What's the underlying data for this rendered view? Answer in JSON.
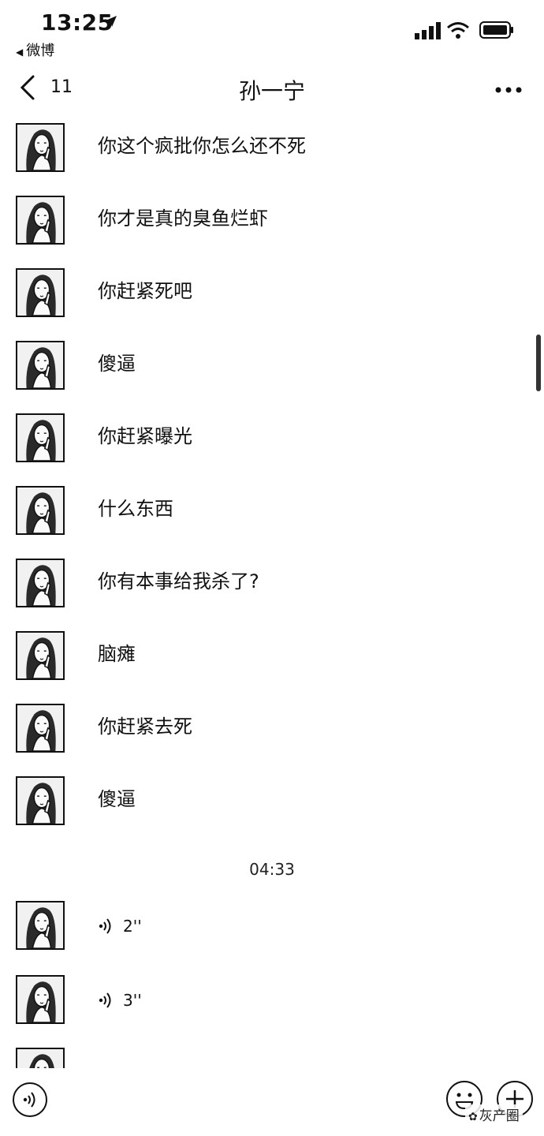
{
  "status_bar": {
    "time": "13:25",
    "back_app_label": "微博"
  },
  "nav": {
    "back_count": "11",
    "title": "孙一宁"
  },
  "messages": [
    {
      "type": "text",
      "text": "你这个疯批你怎么还不死"
    },
    {
      "type": "text",
      "text": "你才是真的臭鱼烂虾"
    },
    {
      "type": "text",
      "text": "你赶紧死吧"
    },
    {
      "type": "text",
      "text": "傻逼"
    },
    {
      "type": "text",
      "text": "你赶紧曝光"
    },
    {
      "type": "text",
      "text": "什么东西"
    },
    {
      "type": "text",
      "text": "你有本事给我杀了?"
    },
    {
      "type": "text",
      "text": "脑瘫"
    },
    {
      "type": "text",
      "text": "你赶紧去死"
    },
    {
      "type": "text",
      "text": "傻逼"
    }
  ],
  "time_divider": "04:33",
  "voice_messages": [
    {
      "type": "voice",
      "duration": "2''"
    },
    {
      "type": "voice",
      "duration": "3''"
    }
  ],
  "watermark": "灰产圈",
  "icons": {
    "status": [
      "location-icon",
      "signal-icon",
      "wifi-icon",
      "battery-icon"
    ],
    "nav": [
      "back-chevron-icon",
      "more-icon"
    ],
    "input": [
      "voice-mode-icon",
      "emoji-icon",
      "plus-icon"
    ]
  }
}
